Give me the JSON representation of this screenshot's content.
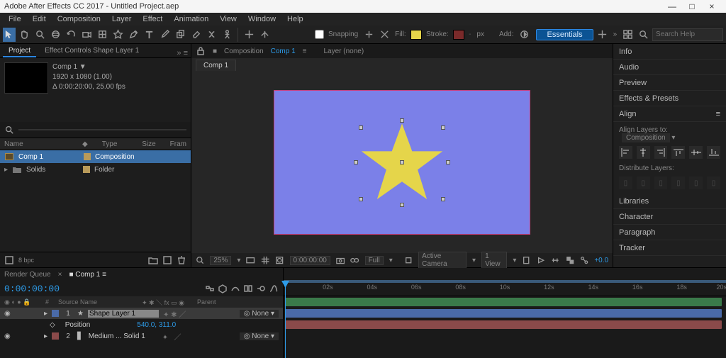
{
  "titlebar": {
    "title": "Adobe After Effects CC 2017 - Untitled Project.aep"
  },
  "menu": {
    "file": "File",
    "edit": "Edit",
    "composition": "Composition",
    "layer": "Layer",
    "effect": "Effect",
    "animation": "Animation",
    "view": "View",
    "window": "Window",
    "help": "Help"
  },
  "toolbar": {
    "snapping": "Snapping",
    "fill": "Fill:",
    "stroke": "Stroke:",
    "px": "px",
    "add": "Add:",
    "workspace": "Essentials",
    "search_ph": "Search Help",
    "fill_color": "#e5d54a",
    "stroke_color": "#7a2a2a"
  },
  "project": {
    "tab": "Project",
    "fx_tab": "Effect Controls Shape Layer 1",
    "comp_name": "Comp 1 ▼",
    "res": "1920 x 1080 (1.00)",
    "dur": "Δ 0:00:20:00, 25.00 fps",
    "cols": {
      "name": "Name",
      "type": "Type",
      "size": "Size",
      "fram": "Fram"
    },
    "items": [
      {
        "name": "Comp 1",
        "type": "Composition",
        "sel": true,
        "folder": false
      },
      {
        "name": "Solids",
        "type": "Folder",
        "sel": false,
        "folder": true
      }
    ],
    "bpc": "8 bpc"
  },
  "composition": {
    "panel_label": "Composition",
    "comp_link": "Comp 1",
    "layer_label": "Layer (none)",
    "tab": "Comp 1",
    "bg": "#7b80e8",
    "star_fill": "#e5d54a"
  },
  "viewer_footer": {
    "zoom": "25%",
    "tc": "0:00:00:00",
    "quality": "Full",
    "camera": "Active Camera",
    "views": "1 View",
    "exposure": "+0.0"
  },
  "right_panels": {
    "info": "Info",
    "audio": "Audio",
    "preview": "Preview",
    "fx": "Effects & Presets",
    "align": "Align",
    "align_to_lbl": "Align Layers to:",
    "align_to": "Composition",
    "dist": "Distribute Layers:",
    "libraries": "Libraries",
    "character": "Character",
    "paragraph": "Paragraph",
    "tracker": "Tracker"
  },
  "timeline": {
    "rq_tab": "Render Queue",
    "comp_tab": "Comp 1",
    "timecode": "0:00:00:00",
    "cols": {
      "src": "Source Name",
      "parent": "Parent"
    },
    "layers": [
      {
        "n": "1",
        "name": "Shape Layer 1",
        "parent": "None",
        "color": "#4a6aa8",
        "bar": "#3a7a4a",
        "sel": true,
        "prop": "Position",
        "val": "540.0, 311.0"
      },
      {
        "n": "2",
        "name": "Medium ... Solid 1",
        "parent": "None",
        "color": "#8a4a4a",
        "bar": "#8a4a4a",
        "sel": false
      }
    ],
    "ruler": [
      "02s",
      "04s",
      "06s",
      "08s",
      "10s",
      "12s",
      "14s",
      "16s",
      "18s",
      "20s"
    ]
  }
}
